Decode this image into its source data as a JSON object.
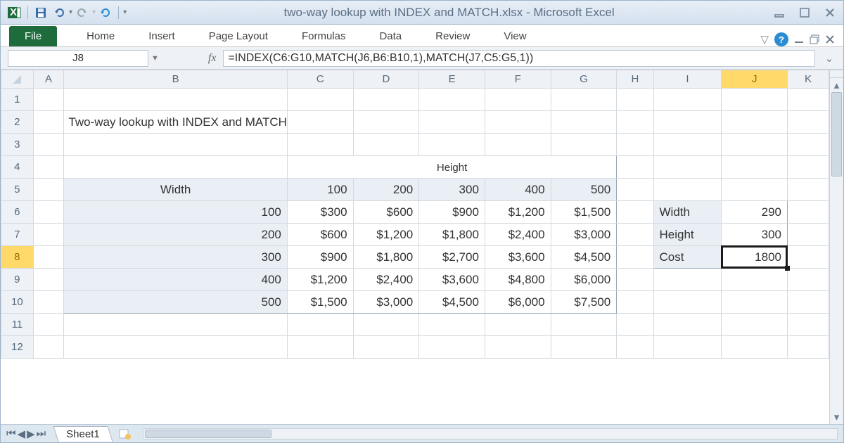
{
  "app": {
    "title": "two-way lookup with INDEX and MATCH.xlsx  -  Microsoft Excel"
  },
  "ribbon": {
    "file": "File",
    "tabs": [
      "Home",
      "Insert",
      "Page Layout",
      "Formulas",
      "Data",
      "Review",
      "View"
    ]
  },
  "namebox": "J8",
  "fx": "fx",
  "formula": "=INDEX(C6:G10,MATCH(J6,B6:B10,1),MATCH(J7,C5:G5,1))",
  "cols": [
    "A",
    "B",
    "C",
    "D",
    "E",
    "F",
    "G",
    "H",
    "I",
    "J",
    "K"
  ],
  "rows": [
    "1",
    "2",
    "3",
    "4",
    "5",
    "6",
    "7",
    "8",
    "9",
    "10",
    "11",
    "12"
  ],
  "heading": "Two-way lookup with INDEX and MATCH",
  "table": {
    "corner": "Width",
    "topHeader": "Height",
    "widths": [
      "100",
      "200",
      "300",
      "400",
      "500"
    ],
    "heights": [
      "100",
      "200",
      "300",
      "400",
      "500"
    ],
    "data": [
      [
        "$300",
        "$600",
        "$900",
        "$1,200",
        "$1,500"
      ],
      [
        "$600",
        "$1,200",
        "$1,800",
        "$2,400",
        "$3,000"
      ],
      [
        "$900",
        "$1,800",
        "$2,700",
        "$3,600",
        "$4,500"
      ],
      [
        "$1,200",
        "$2,400",
        "$3,600",
        "$4,800",
        "$6,000"
      ],
      [
        "$1,500",
        "$3,000",
        "$4,500",
        "$6,000",
        "$7,500"
      ]
    ]
  },
  "lookup": {
    "labels": [
      "Width",
      "Height",
      "Cost"
    ],
    "values": [
      "290",
      "300",
      "1800"
    ]
  },
  "sheetTab": "Sheet1"
}
